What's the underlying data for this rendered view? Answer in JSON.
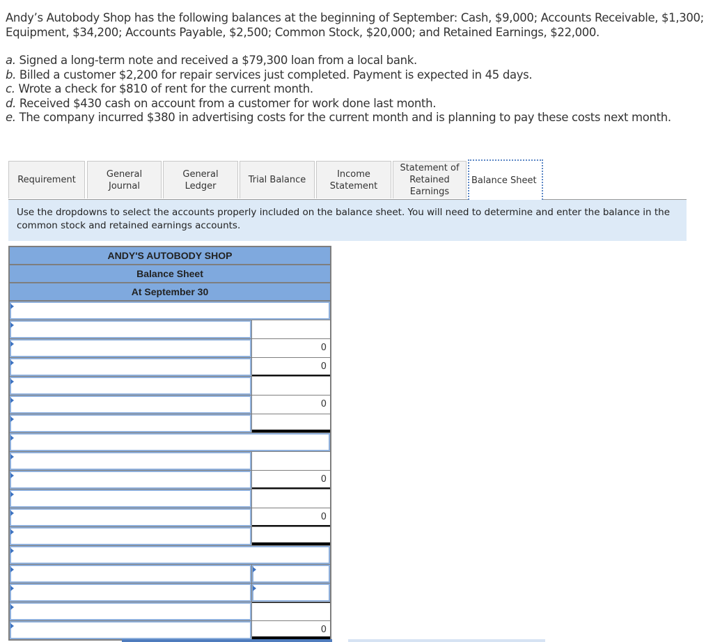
{
  "problem": {
    "intro": "Andy’s Autobody Shop has the following balances at the beginning of September: Cash, $9,000; Accounts Receivable, $1,300; Equipment, $34,200; Accounts Payable, $2,500; Common Stock, $20,000; and Retained Earnings, $22,000.",
    "transactions": [
      {
        "letter": "a.",
        "text": " Signed a long-term note and received a $79,300 loan from a local bank."
      },
      {
        "letter": "b.",
        "text": " Billed a customer $2,200 for repair services just completed. Payment is expected in 45 days."
      },
      {
        "letter": "c.",
        "text": " Wrote a check for $810 of rent for the current month."
      },
      {
        "letter": "d.",
        "text": " Received $430 cash on account from a customer for work done last month."
      },
      {
        "letter": "e.",
        "text": " The company incurred $380 in advertising costs for the current month and is planning to pay these costs next month."
      }
    ]
  },
  "tabs": [
    {
      "label": "Requirement",
      "active": false
    },
    {
      "label": "General Journal",
      "active": false
    },
    {
      "label": "General Ledger",
      "active": false
    },
    {
      "label": "Trial Balance",
      "active": false
    },
    {
      "label": "Income Statement",
      "active": false
    },
    {
      "label": "Statement of Retained Earnings",
      "active": false
    },
    {
      "label": "Balance Sheet",
      "active": true
    }
  ],
  "instructions": "Use the dropdowns to select the accounts properly included on the balance sheet. You will need to determine and enter the balance in the common stock and retained earnings accounts.",
  "balance_sheet": {
    "company": "ANDY'S AUTOBODY SHOP",
    "title": "Balance Sheet",
    "date": "At September 30",
    "rows": [
      {
        "type": "full",
        "account": ""
      },
      {
        "type": "line",
        "account": "",
        "amount": ""
      },
      {
        "type": "line",
        "account": "",
        "amount": "0"
      },
      {
        "type": "line",
        "account": "",
        "amount": "0"
      },
      {
        "type": "line",
        "account": "",
        "amount": ""
      },
      {
        "type": "line",
        "account": "",
        "amount": "0"
      },
      {
        "type": "line",
        "account": "",
        "amount": ""
      },
      {
        "type": "full",
        "account": ""
      },
      {
        "type": "line",
        "account": "",
        "amount": ""
      },
      {
        "type": "line",
        "account": "",
        "amount": "0"
      },
      {
        "type": "line",
        "account": "",
        "amount": ""
      },
      {
        "type": "line",
        "account": "",
        "amount": "0"
      },
      {
        "type": "line",
        "account": "",
        "amount": ""
      },
      {
        "type": "full",
        "account": ""
      },
      {
        "type": "line-dd",
        "account": "",
        "amount": ""
      },
      {
        "type": "line-dd",
        "account": "",
        "amount": ""
      },
      {
        "type": "line",
        "account": "",
        "amount": ""
      },
      {
        "type": "line",
        "account": "",
        "amount": "0"
      }
    ]
  },
  "colors": {
    "header_blue": "#7fa9de",
    "instruction_bg": "#ddeaf7",
    "dropdown_border": "#8fb0dc",
    "dropdown_marker": "#3e73c0"
  }
}
